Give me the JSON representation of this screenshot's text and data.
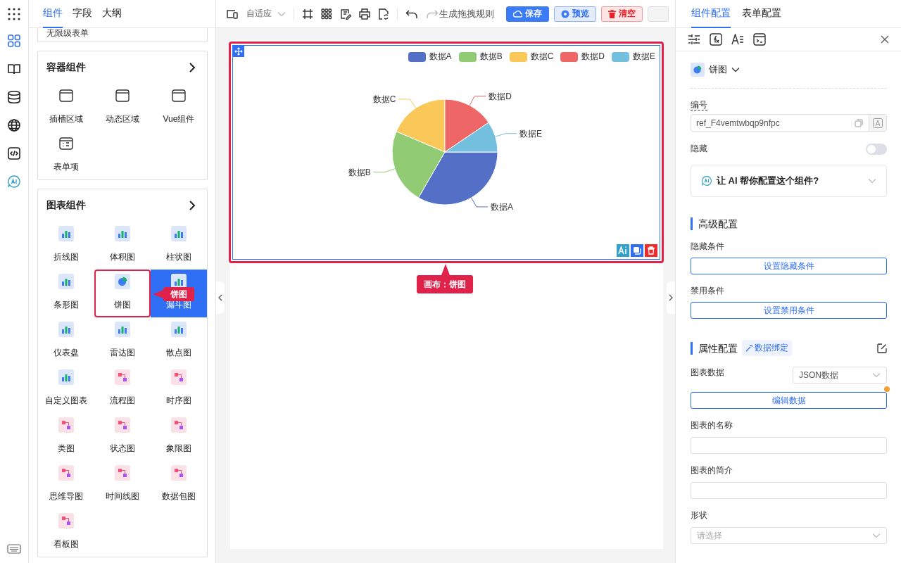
{
  "rail_items": [
    {
      "selected": true
    },
    {
      "selected": false
    },
    {
      "selected": false
    },
    {
      "selected": false
    },
    {
      "selected": false
    },
    {
      "selected": false
    }
  ],
  "left_tabs": [
    {
      "label": "组件",
      "selected": true
    },
    {
      "label": "字段",
      "selected": false
    },
    {
      "label": "大纲",
      "selected": false
    }
  ],
  "partial_card": {
    "label": "无限级表单"
  },
  "groups": [
    {
      "title": "容器组件",
      "items": [
        {
          "label": "插槽区域",
          "selected": false,
          "hovered": false
        },
        {
          "label": "动态区域",
          "selected": false,
          "hovered": false
        },
        {
          "label": "Vue组件",
          "selected": false,
          "hovered": false
        },
        {
          "label": "表单项",
          "selected": false,
          "hovered": false
        }
      ]
    },
    {
      "title": "图表组件",
      "items": [
        {
          "label": "折线图",
          "selected": false,
          "hovered": false
        },
        {
          "label": "体积图",
          "selected": false,
          "hovered": false
        },
        {
          "label": "柱状图",
          "selected": false,
          "hovered": false
        },
        {
          "label": "条形图",
          "selected": false,
          "hovered": false
        },
        {
          "label": "饼图",
          "selected": true,
          "hovered": false
        },
        {
          "label": "漏斗图",
          "selected": false,
          "hovered": true
        },
        {
          "label": "仪表盘",
          "selected": false,
          "hovered": false
        },
        {
          "label": "雷达图",
          "selected": false,
          "hovered": false
        },
        {
          "label": "散点图",
          "selected": false,
          "hovered": false
        },
        {
          "label": "自定义图表",
          "selected": false,
          "hovered": false
        },
        {
          "label": "流程图",
          "selected": false,
          "hovered": false
        },
        {
          "label": "时序图",
          "selected": false,
          "hovered": false
        },
        {
          "label": "类图",
          "selected": false,
          "hovered": false
        },
        {
          "label": "状态图",
          "selected": false,
          "hovered": false
        },
        {
          "label": "象限图",
          "selected": false,
          "hovered": false
        },
        {
          "label": "思维导图",
          "selected": false,
          "hovered": false
        },
        {
          "label": "时间线图",
          "selected": false,
          "hovered": false
        },
        {
          "label": "数据包图",
          "selected": false,
          "hovered": false
        },
        {
          "label": "看板图",
          "selected": false,
          "hovered": false
        }
      ]
    }
  ],
  "item_tooltip": "饼图",
  "toolbar": {
    "device_select": "自适应",
    "redo_disabled": true,
    "generate_rule": "生成拖拽规则",
    "buttons": [
      {
        "label": "保存",
        "kind": "primary"
      },
      {
        "label": "预览",
        "kind": "info"
      },
      {
        "label": "清空",
        "kind": "danger"
      },
      {
        "kind": "partial"
      }
    ]
  },
  "chart": {
    "legend": [
      {
        "label": "数据A",
        "color": "#5470c6"
      },
      {
        "label": "数据B",
        "color": "#91cc75"
      },
      {
        "label": "数据C",
        "color": "#fac858"
      },
      {
        "label": "数据D",
        "color": "#ee6666"
      },
      {
        "label": "数据E",
        "color": "#73c0de"
      }
    ],
    "slices": [
      {
        "label": "数据A",
        "color": "#5470c6"
      },
      {
        "label": "数据B",
        "color": "#91cc75"
      },
      {
        "label": "数据C",
        "color": "#fac858"
      },
      {
        "label": "数据D",
        "color": "#ee6666"
      },
      {
        "label": "数据E",
        "color": "#73c0de"
      }
    ]
  },
  "canvas_tooltip": "画布：饼图",
  "right_tabs": [
    {
      "label": "组件配置",
      "selected": true
    },
    {
      "label": "表单配置",
      "selected": false
    }
  ],
  "component_type": "饼图",
  "id_field": {
    "label": "编号",
    "value": "ref_F4vemtwbqp9nfpc"
  },
  "hidden_toggle": {
    "label": "隐藏",
    "on": false
  },
  "ai_helper": "让 AI 帮你配置这个组件?",
  "advanced": {
    "title": "高级配置",
    "fields": [
      {
        "label": "隐藏条件",
        "button": "设置隐藏条件"
      },
      {
        "label": "禁用条件",
        "button": "设置禁用条件"
      }
    ]
  },
  "props": {
    "title": "属性配置",
    "tag": "数据绑定",
    "data_select": {
      "label": "图表数据",
      "value": "JSON数据"
    },
    "edit_button": {
      "label": "编辑数据",
      "modified": true
    },
    "inputs": [
      {
        "label": "图表的名称"
      },
      {
        "label": "图表的简介"
      }
    ],
    "shape_select": {
      "label": "形状",
      "placeholder": "请选择"
    }
  }
}
